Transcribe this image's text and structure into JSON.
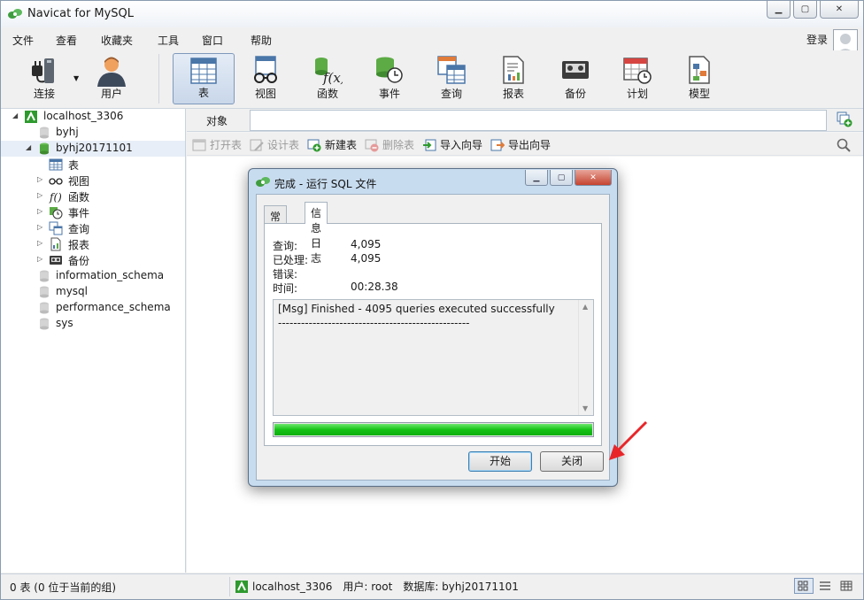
{
  "window": {
    "title": "Navicat for MySQL"
  },
  "menu": [
    "文件",
    "查看",
    "收藏夹",
    "工具",
    "窗口",
    "帮助"
  ],
  "user_area": {
    "login": "登录"
  },
  "toolbar": {
    "connect": "连接",
    "user": "用户",
    "table": "表",
    "view": "视图",
    "function": "函数",
    "event": "事件",
    "query": "查询",
    "report": "报表",
    "backup": "备份",
    "schedule": "计划",
    "model": "模型",
    "active": "表"
  },
  "tree": {
    "connection": "localhost_3306",
    "databases": [
      {
        "name": "byhj"
      },
      {
        "name": "byhj20171101"
      },
      {
        "name": "information_schema"
      },
      {
        "name": "mysql"
      },
      {
        "name": "performance_schema"
      },
      {
        "name": "sys"
      }
    ],
    "children": [
      "表",
      "视图",
      "函数",
      "事件",
      "查询",
      "报表",
      "备份"
    ]
  },
  "object_bar": {
    "label": "对象",
    "filter_value": ""
  },
  "object_toolbar": {
    "open_table": "打开表",
    "design_table": "设计表",
    "new_table": "新建表",
    "delete_table": "删除表",
    "import_wizard": "导入向导",
    "export_wizard": "导出向导"
  },
  "status": {
    "left": "0 表 (0 位于当前的组)",
    "connection": "localhost_3306",
    "user": "用户: root",
    "database": "数据库: byhj20171101"
  },
  "dialog": {
    "title": "完成 - 运行 SQL 文件",
    "tabs": [
      "常规",
      "信息日志"
    ],
    "active_tab": "信息日志",
    "fields": {
      "query_label": "查询:",
      "query_value": "4,095",
      "processed_label": "已处理:",
      "processed_value": "4,095",
      "errors_label": "错误:",
      "errors_value": "",
      "time_label": "时间:",
      "time_value": "00:28.38"
    },
    "log": [
      "[Msg] Finished - 4095 queries executed successfully",
      "--------------------------------------------------"
    ],
    "progress": 1.0,
    "buttons": {
      "start": "开始",
      "close": "关闭"
    }
  },
  "colors": {
    "progress_green": "#15c215",
    "annotation_red": "#e8262a",
    "navicat_green": "#2e9a2e",
    "selection": "#e7eef7"
  }
}
